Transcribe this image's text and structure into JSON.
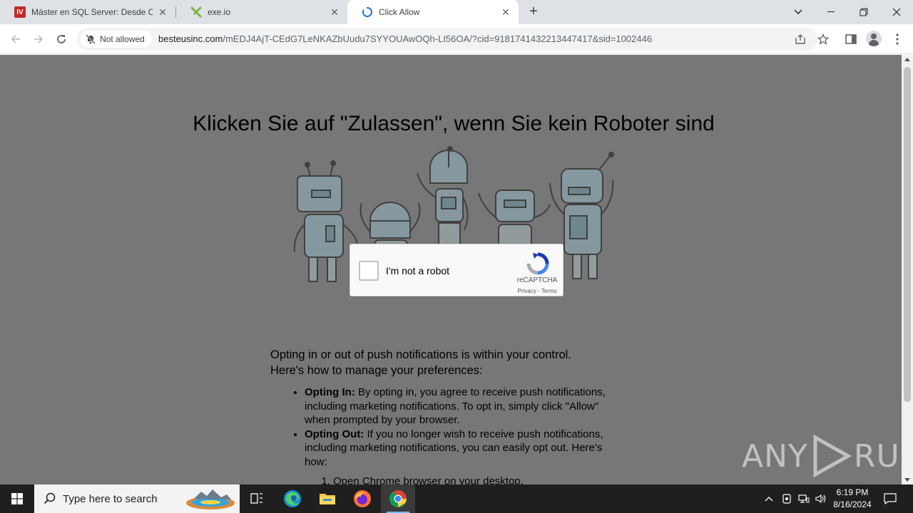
{
  "browser": {
    "tabs": [
      {
        "title": "Máster en SQL Server: Desde Cero",
        "favicon": "iv-logo-icon",
        "active": false
      },
      {
        "title": "exe.io",
        "favicon": "exeio-logo-icon",
        "active": false
      },
      {
        "title": "Click Allow",
        "favicon": "loading-spinner-icon",
        "active": true
      }
    ],
    "new_tab": "+",
    "address": {
      "permission_chip": "Not allowed",
      "host": "besteusinc.com",
      "path": "/mEDJ4AjT-CEdG7LeNKAZbUudu7SYYOUAwOQh-LI56OA/?cid=9181741432213447417&sid=1002446"
    }
  },
  "page": {
    "headline": "Klicken Sie auf \"Zulassen\", wenn Sie kein Roboter sind",
    "captcha": {
      "label": "I'm not a robot",
      "brand": "reCAPTCHA",
      "links": "Privacy - Terms"
    },
    "article": {
      "intro_line1": "Opting in or out of push notifications is within your control.",
      "intro_line2": "Here's how to manage your preferences:",
      "items": [
        {
          "title": "Opting In:",
          "text": " By opting in, you agree to receive push notifications, including marketing notifications. To opt in, simply click \"Allow\" when prompted by your browser."
        },
        {
          "title": "Opting Out:",
          "text": " If you no longer wish to receive push notifications, including marketing notifications, you can easily opt out. Here's how:"
        }
      ],
      "steps": [
        "Open Chrome browser on your desktop."
      ]
    },
    "watermark_left": "ANY",
    "watermark_right": "RUN"
  },
  "taskbar": {
    "search_placeholder": "Type here to search",
    "time": "6:19 PM",
    "date": "8/16/2024"
  },
  "colors": {
    "page_overlay": "#777777",
    "tab_strip": "#dee1e6",
    "taskbar": "#1f1f1f"
  }
}
